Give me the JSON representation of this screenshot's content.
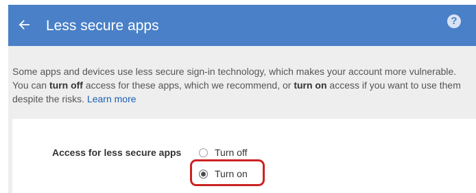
{
  "header": {
    "back_icon": "arrow-left-icon",
    "title": "Less secure apps",
    "help_icon": "help-circle-icon",
    "help_glyph": "?",
    "background_color": "#4a80c7"
  },
  "description": {
    "text_1": "Some apps and devices use less secure sign-in technology, which makes your account more vulnerable. You can ",
    "bold_1": "turn off",
    "text_2": " access for these apps, which we recommend, or ",
    "bold_2": "turn on",
    "text_3": " access if you want to use them despite the risks. ",
    "learn_more": "Learn more"
  },
  "setting": {
    "label": "Access for less secure apps",
    "options": [
      {
        "label": "Turn off",
        "selected": false
      },
      {
        "label": "Turn on",
        "selected": true
      }
    ],
    "highlight_color": "#cc2222"
  }
}
